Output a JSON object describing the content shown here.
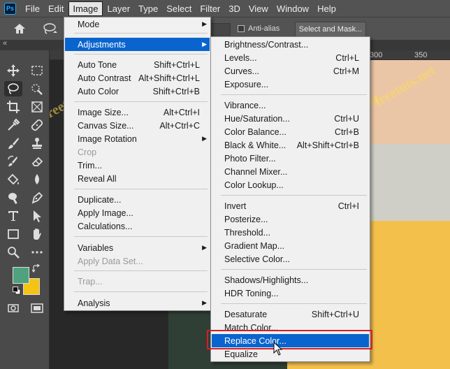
{
  "menubar": {
    "logo": "Ps",
    "items": [
      "File",
      "Edit",
      "Image",
      "Layer",
      "Type",
      "Select",
      "Filter",
      "3D",
      "View",
      "Window",
      "Help"
    ],
    "active": "Image"
  },
  "options": {
    "anti_alias_label": "Anti-alias",
    "select_mask_label": "Select and Mask..."
  },
  "ruler": {
    "marks": [
      "300",
      "350"
    ]
  },
  "watermark": "freetuts.net",
  "colors": {
    "foreground": "#4ea27d",
    "background": "#f5c314",
    "highlight": "#0a64ce",
    "annotation": "#d91d26"
  },
  "image_menu": {
    "mode": {
      "label": "Mode"
    },
    "adjustments": {
      "label": "Adjustments"
    },
    "auto_tone": {
      "label": "Auto Tone",
      "shortcut": "Shift+Ctrl+L"
    },
    "auto_contrast": {
      "label": "Auto Contrast",
      "shortcut": "Alt+Shift+Ctrl+L"
    },
    "auto_color": {
      "label": "Auto Color",
      "shortcut": "Shift+Ctrl+B"
    },
    "image_size": {
      "label": "Image Size...",
      "shortcut": "Alt+Ctrl+I"
    },
    "canvas_size": {
      "label": "Canvas Size...",
      "shortcut": "Alt+Ctrl+C"
    },
    "image_rotation": {
      "label": "Image Rotation"
    },
    "crop": {
      "label": "Crop"
    },
    "trim": {
      "label": "Trim..."
    },
    "reveal_all": {
      "label": "Reveal All"
    },
    "duplicate": {
      "label": "Duplicate..."
    },
    "apply_image": {
      "label": "Apply Image..."
    },
    "calculations": {
      "label": "Calculations..."
    },
    "variables": {
      "label": "Variables"
    },
    "apply_data_set": {
      "label": "Apply Data Set..."
    },
    "trap": {
      "label": "Trap..."
    },
    "analysis": {
      "label": "Analysis"
    }
  },
  "adjustments_menu": {
    "brightness_contrast": {
      "label": "Brightness/Contrast..."
    },
    "levels": {
      "label": "Levels...",
      "shortcut": "Ctrl+L"
    },
    "curves": {
      "label": "Curves...",
      "shortcut": "Ctrl+M"
    },
    "exposure": {
      "label": "Exposure..."
    },
    "vibrance": {
      "label": "Vibrance..."
    },
    "hue_saturation": {
      "label": "Hue/Saturation...",
      "shortcut": "Ctrl+U"
    },
    "color_balance": {
      "label": "Color Balance...",
      "shortcut": "Ctrl+B"
    },
    "black_white": {
      "label": "Black & White...",
      "shortcut": "Alt+Shift+Ctrl+B"
    },
    "photo_filter": {
      "label": "Photo Filter..."
    },
    "channel_mixer": {
      "label": "Channel Mixer..."
    },
    "color_lookup": {
      "label": "Color Lookup..."
    },
    "invert": {
      "label": "Invert",
      "shortcut": "Ctrl+I"
    },
    "posterize": {
      "label": "Posterize..."
    },
    "threshold": {
      "label": "Threshold..."
    },
    "gradient_map": {
      "label": "Gradient Map..."
    },
    "selective_color": {
      "label": "Selective Color..."
    },
    "shadows_highlights": {
      "label": "Shadows/Highlights..."
    },
    "hdr_toning": {
      "label": "HDR Toning..."
    },
    "desaturate": {
      "label": "Desaturate",
      "shortcut": "Shift+Ctrl+U"
    },
    "match_color": {
      "label": "Match Color..."
    },
    "replace_color": {
      "label": "Replace Color..."
    },
    "equalize": {
      "label": "Equalize"
    }
  }
}
